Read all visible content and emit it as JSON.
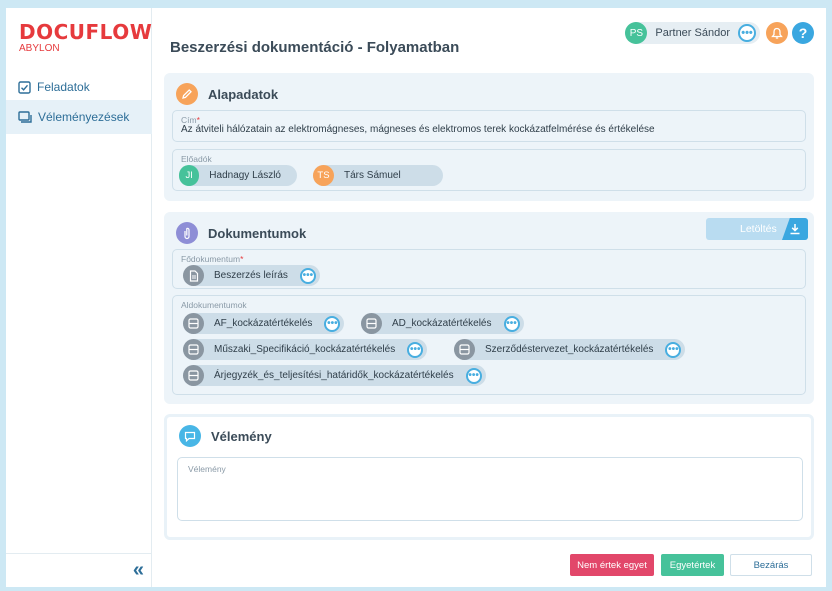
{
  "brand": {
    "name": "DOCUFLOW",
    "sub": "ABYLON"
  },
  "sidebar": {
    "items": [
      {
        "label": "Feladatok",
        "icon": "task-check-icon"
      },
      {
        "label": "Véleményezések",
        "icon": "review-chat-icon"
      }
    ],
    "collapse_glyph": "«"
  },
  "header": {
    "title": "Beszerzési dokumentáció - Folyamatban",
    "user": {
      "initials": "PS",
      "name": "Partner Sándor",
      "avatar_color": "#46c29a"
    },
    "more": "•••",
    "help": "?"
  },
  "alapadatok": {
    "title": "Alapadatok",
    "cim_label": "Cím",
    "cim_required": "*",
    "cim_value": "Az átviteli hálózatain az elektromágneses, mágneses és elektromos terek kockázatfelmérése és értékelése",
    "eloadok_label": "Előadók",
    "presenters": [
      {
        "initials": "JI",
        "name": "Hadnagy László",
        "color": "#46c29a"
      },
      {
        "initials": "TS",
        "name": "Társ Sámuel",
        "color": "#f7a35a"
      }
    ]
  },
  "dokumentumok": {
    "title": "Dokumentumok",
    "download_label": "Letöltés",
    "main_label": "Fődokumentum",
    "main_required": "*",
    "main_doc": "Beszerzés leírás",
    "sub_label": "Aldokumentumok",
    "sub_docs": [
      "AF_kockázatértékelés",
      "AD_kockázatértékelés",
      "Műszaki_Specifikáció_kockázatértékelés",
      "Szerződéstervezet_kockázatértékelés",
      "Árjegyzék_és_teljesítési_határidők_kockázatértékelés"
    ],
    "more": "•••"
  },
  "velemeny": {
    "title": "Vélemény",
    "placeholder": "Vélemény"
  },
  "footer": {
    "reject_label": "Nem értek egyet",
    "agree_label": "Egyetértek",
    "close_label": "Bezárás"
  },
  "colors": {
    "brand_red": "#e63a3d",
    "primary_blue": "#3aa7e0",
    "reject_pink": "#e2476a",
    "agree_green": "#46c29a"
  }
}
